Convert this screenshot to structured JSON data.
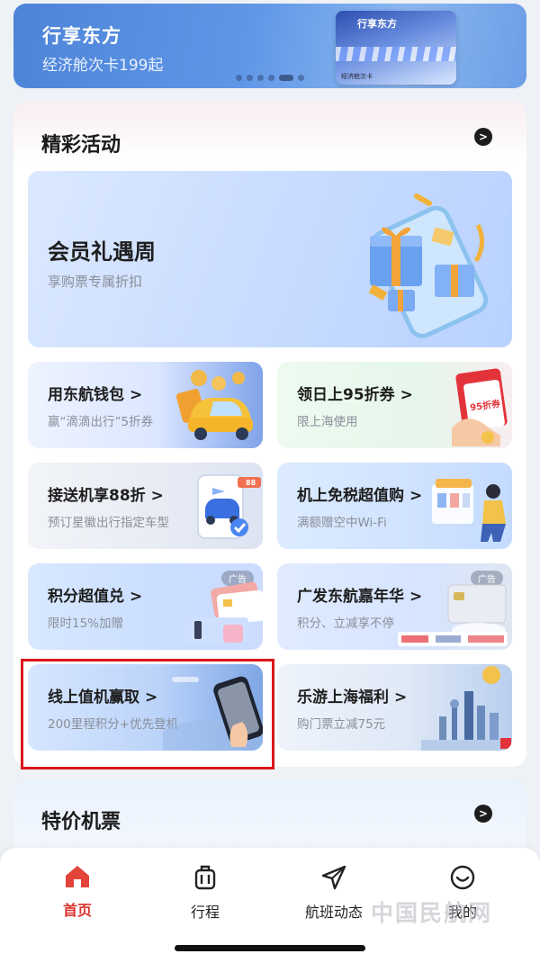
{
  "banner": {
    "title": "行享东方",
    "subtitle": "经济舱次卡199起",
    "card_title": "行享东方",
    "card_caption": "经济舱次卡",
    "dot_count": 6,
    "active_dot_index": 4
  },
  "highlights": {
    "title": "精彩活动",
    "featured": {
      "title": "会员礼遇周",
      "subtitle": "享购票专属折扣"
    },
    "tiles": [
      {
        "title": "用东航钱包",
        "subtitle": "赢“滴滴出行”5折券",
        "ad": ""
      },
      {
        "title": "领日上95折券",
        "subtitle": "限上海使用",
        "ad": "",
        "badge": "95折券"
      },
      {
        "title": "接送机享88折",
        "subtitle": "预订星徽出行指定车型",
        "ad": "",
        "badge": "88"
      },
      {
        "title": "机上免税超值购",
        "subtitle": "满额赠空中Wi-Fi",
        "ad": ""
      },
      {
        "title": "积分超值兑",
        "subtitle": "限时15%加赠",
        "ad": "广告"
      },
      {
        "title": "广发东航嘉年华",
        "subtitle": "积分、立减享不停",
        "ad": "广告"
      },
      {
        "title": "线上值机赢取",
        "subtitle": "200里程积分+优先登机",
        "ad": ""
      },
      {
        "title": "乐游上海福利",
        "subtitle": "购门票立减75元",
        "ad": ""
      }
    ]
  },
  "deals": {
    "title": "特价机票"
  },
  "tabbar": {
    "items": [
      {
        "label": "首页",
        "icon": "home-icon",
        "active": true
      },
      {
        "label": "行程",
        "icon": "luggage-icon",
        "active": false
      },
      {
        "label": "航班动态",
        "icon": "paper-plane-icon",
        "active": false
      },
      {
        "label": "我的",
        "icon": "smiley-icon",
        "active": false
      }
    ]
  },
  "watermark": "中国民航网",
  "chevron": ">",
  "colors": {
    "accent": "#d9322b",
    "highlight_border": "#d9161b"
  }
}
